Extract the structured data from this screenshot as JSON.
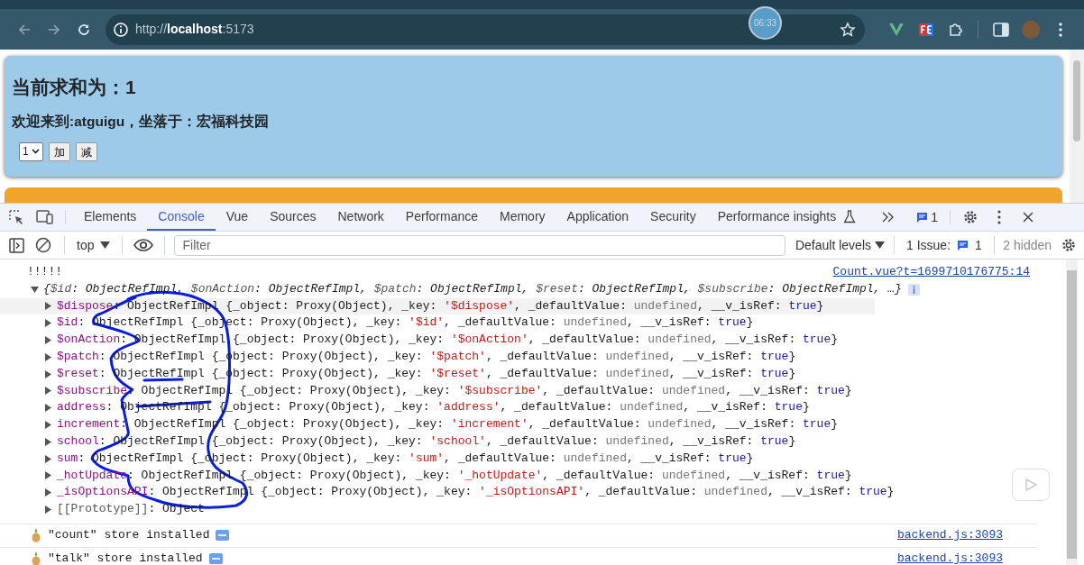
{
  "browser": {
    "url": "http://**localhost**:5173",
    "timer": "06:33"
  },
  "page": {
    "heading": "当前求和为：1",
    "subheading": "欢迎来到:atguigu，坐落于：宏福科技园",
    "select_value": "1",
    "buttons": [
      "加",
      "减"
    ]
  },
  "devtools": {
    "tabs": [
      {
        "label": "Elements",
        "selected": false
      },
      {
        "label": "Console",
        "selected": true
      },
      {
        "label": "Vue",
        "selected": false
      },
      {
        "label": "Sources",
        "selected": false
      },
      {
        "label": "Network",
        "selected": false
      },
      {
        "label": "Performance",
        "selected": false
      },
      {
        "label": "Memory",
        "selected": false
      },
      {
        "label": "Application",
        "selected": false
      },
      {
        "label": "Security",
        "selected": false
      },
      {
        "label": "Performance insights",
        "selected": false
      }
    ],
    "message_count": "1",
    "toolbar": {
      "context": "top",
      "filter_placeholder": "Filter",
      "levels": "Default levels",
      "issues_label": "1 Issue:",
      "issues_count": "1",
      "hidden": "2 hidden"
    }
  },
  "console": {
    "messages": [
      {
        "kind": "log",
        "parts": [
          {
            "kind": "plain",
            "text": "!!!!!"
          }
        ],
        "source": "Count.vue?t=1699710176775:14"
      },
      {
        "kind": "object",
        "expanded": true,
        "summary": [
          {
            "kind": "plain",
            "text": "{"
          },
          {
            "kind": "prop",
            "text": "$id"
          },
          {
            "kind": "plain",
            "text": ": ObjectRefImpl, "
          },
          {
            "kind": "prop",
            "text": "$onAction"
          },
          {
            "kind": "plain",
            "text": ": ObjectRefImpl, "
          },
          {
            "kind": "prop",
            "text": "$patch"
          },
          {
            "kind": "plain",
            "text": ": ObjectRefImpl, "
          },
          {
            "kind": "prop",
            "text": "$reset"
          },
          {
            "kind": "plain",
            "text": ": ObjectRefImpl, "
          },
          {
            "kind": "prop",
            "text": "$subscribe"
          },
          {
            "kind": "plain",
            "text": ": ObjectRefImpl, …}"
          }
        ],
        "properties": [
          {
            "selected": true,
            "parts": [
              {
                "kind": "key",
                "text": "$dispose"
              },
              {
                "kind": "plain",
                "text": ": ObjectRefImpl {_object: Proxy(Object), _key: "
              },
              {
                "kind": "string",
                "text": "'$dispose'"
              },
              {
                "kind": "plain",
                "text": ", _defaultValue: "
              },
              {
                "kind": "undef",
                "text": "undefined"
              },
              {
                "kind": "plain",
                "text": ", __v_isRef: "
              },
              {
                "kind": "bool",
                "text": "true"
              },
              {
                "kind": "plain",
                "text": "}"
              }
            ]
          },
          {
            "selected": false,
            "parts": [
              {
                "kind": "key",
                "text": "$id"
              },
              {
                "kind": "plain",
                "text": ": ObjectRefImpl {_object: Proxy(Object), _key: "
              },
              {
                "kind": "string",
                "text": "'$id'"
              },
              {
                "kind": "plain",
                "text": ", _defaultValue: "
              },
              {
                "kind": "undef",
                "text": "undefined"
              },
              {
                "kind": "plain",
                "text": ", __v_isRef: "
              },
              {
                "kind": "bool",
                "text": "true"
              },
              {
                "kind": "plain",
                "text": "}"
              }
            ]
          },
          {
            "selected": false,
            "parts": [
              {
                "kind": "key",
                "text": "$onAction"
              },
              {
                "kind": "plain",
                "text": ": ObjectRefImpl {_object: Proxy(Object), _key: "
              },
              {
                "kind": "string",
                "text": "'$onAction'"
              },
              {
                "kind": "plain",
                "text": ", _defaultValue: "
              },
              {
                "kind": "undef",
                "text": "undefined"
              },
              {
                "kind": "plain",
                "text": ", __v_isRef: "
              },
              {
                "kind": "bool",
                "text": "true"
              },
              {
                "kind": "plain",
                "text": "}"
              }
            ]
          },
          {
            "selected": false,
            "parts": [
              {
                "kind": "key",
                "text": "$patch"
              },
              {
                "kind": "plain",
                "text": ": ObjectRefImpl {_object: Proxy(Object), _key: "
              },
              {
                "kind": "string",
                "text": "'$patch'"
              },
              {
                "kind": "plain",
                "text": ", _defaultValue: "
              },
              {
                "kind": "undef",
                "text": "undefined"
              },
              {
                "kind": "plain",
                "text": ", __v_isRef: "
              },
              {
                "kind": "bool",
                "text": "true"
              },
              {
                "kind": "plain",
                "text": "}"
              }
            ]
          },
          {
            "selected": false,
            "parts": [
              {
                "kind": "key",
                "text": "$reset"
              },
              {
                "kind": "plain",
                "text": ": ObjectRefImpl {_object: Proxy(Object), _key: "
              },
              {
                "kind": "string",
                "text": "'$reset'"
              },
              {
                "kind": "plain",
                "text": ", _defaultValue: "
              },
              {
                "kind": "undef",
                "text": "undefined"
              },
              {
                "kind": "plain",
                "text": ", __v_isRef: "
              },
              {
                "kind": "bool",
                "text": "true"
              },
              {
                "kind": "plain",
                "text": "}"
              }
            ]
          },
          {
            "selected": false,
            "parts": [
              {
                "kind": "key",
                "text": "$subscribe"
              },
              {
                "kind": "plain",
                "text": ": ObjectRefImpl {_object: Proxy(Object), _key: "
              },
              {
                "kind": "string",
                "text": "'$subscribe'"
              },
              {
                "kind": "plain",
                "text": ", _defaultValue: "
              },
              {
                "kind": "undef",
                "text": "undefined"
              },
              {
                "kind": "plain",
                "text": ", __v_isRef: "
              },
              {
                "kind": "bool",
                "text": "true"
              },
              {
                "kind": "plain",
                "text": "}"
              }
            ]
          },
          {
            "selected": false,
            "parts": [
              {
                "kind": "key",
                "text": "address"
              },
              {
                "kind": "plain",
                "text": ": ObjectRefImpl {_object: Proxy(Object), _key: "
              },
              {
                "kind": "string",
                "text": "'address'"
              },
              {
                "kind": "plain",
                "text": ", _defaultValue: "
              },
              {
                "kind": "undef",
                "text": "undefined"
              },
              {
                "kind": "plain",
                "text": ", __v_isRef: "
              },
              {
                "kind": "bool",
                "text": "true"
              },
              {
                "kind": "plain",
                "text": "}"
              }
            ]
          },
          {
            "selected": false,
            "parts": [
              {
                "kind": "key",
                "text": "increment"
              },
              {
                "kind": "plain",
                "text": ": ObjectRefImpl {_object: Proxy(Object), _key: "
              },
              {
                "kind": "string",
                "text": "'increment'"
              },
              {
                "kind": "plain",
                "text": ", _defaultValue: "
              },
              {
                "kind": "undef",
                "text": "undefined"
              },
              {
                "kind": "plain",
                "text": ", __v_isRef: "
              },
              {
                "kind": "bool",
                "text": "true"
              },
              {
                "kind": "plain",
                "text": "}"
              }
            ]
          },
          {
            "selected": false,
            "parts": [
              {
                "kind": "key",
                "text": "school"
              },
              {
                "kind": "plain",
                "text": ": ObjectRefImpl {_object: Proxy(Object), _key: "
              },
              {
                "kind": "string",
                "text": "'school'"
              },
              {
                "kind": "plain",
                "text": ", _defaultValue: "
              },
              {
                "kind": "undef",
                "text": "undefined"
              },
              {
                "kind": "plain",
                "text": ", __v_isRef: "
              },
              {
                "kind": "bool",
                "text": "true"
              },
              {
                "kind": "plain",
                "text": "}"
              }
            ]
          },
          {
            "selected": false,
            "parts": [
              {
                "kind": "key",
                "text": "sum"
              },
              {
                "kind": "plain",
                "text": ": ObjectRefImpl {_object: Proxy(Object), _key: "
              },
              {
                "kind": "string",
                "text": "'sum'"
              },
              {
                "kind": "plain",
                "text": ", _defaultValue: "
              },
              {
                "kind": "undef",
                "text": "undefined"
              },
              {
                "kind": "plain",
                "text": ", __v_isRef: "
              },
              {
                "kind": "bool",
                "text": "true"
              },
              {
                "kind": "plain",
                "text": "}"
              }
            ]
          },
          {
            "selected": false,
            "parts": [
              {
                "kind": "key",
                "text": "_hotUpdate"
              },
              {
                "kind": "plain",
                "text": ": ObjectRefImpl {_object: Proxy(Object), _key: "
              },
              {
                "kind": "string",
                "text": "'_hotUpdate'"
              },
              {
                "kind": "plain",
                "text": ", _defaultValue: "
              },
              {
                "kind": "undef",
                "text": "undefined"
              },
              {
                "kind": "plain",
                "text": ", __v_isRef: "
              },
              {
                "kind": "bool",
                "text": "true"
              },
              {
                "kind": "plain",
                "text": "}"
              }
            ]
          },
          {
            "selected": false,
            "parts": [
              {
                "kind": "key",
                "text": "_isOptionsAPI"
              },
              {
                "kind": "plain",
                "text": ": ObjectRefImpl {_object: Proxy(Object), _key: "
              },
              {
                "kind": "string",
                "text": "'_isOptionsAPI'"
              },
              {
                "kind": "plain",
                "text": ", _defaultValue: "
              },
              {
                "kind": "undef",
                "text": "undefined"
              },
              {
                "kind": "plain",
                "text": ", __v_isRef: "
              },
              {
                "kind": "bool",
                "text": "true"
              },
              {
                "kind": "plain",
                "text": "}"
              }
            ]
          },
          {
            "selected": false,
            "parts": [
              {
                "kind": "proto",
                "text": "[[Prototype]]"
              },
              {
                "kind": "plain",
                "text": ": Object"
              }
            ]
          }
        ]
      },
      {
        "kind": "store",
        "parts": [
          {
            "kind": "plain",
            "text": "\"count\" store installed"
          }
        ],
        "source": "backend.js:3093"
      },
      {
        "kind": "store",
        "parts": [
          {
            "kind": "plain",
            "text": "\"talk\" store installed"
          }
        ],
        "source": "backend.js:3093"
      }
    ]
  }
}
